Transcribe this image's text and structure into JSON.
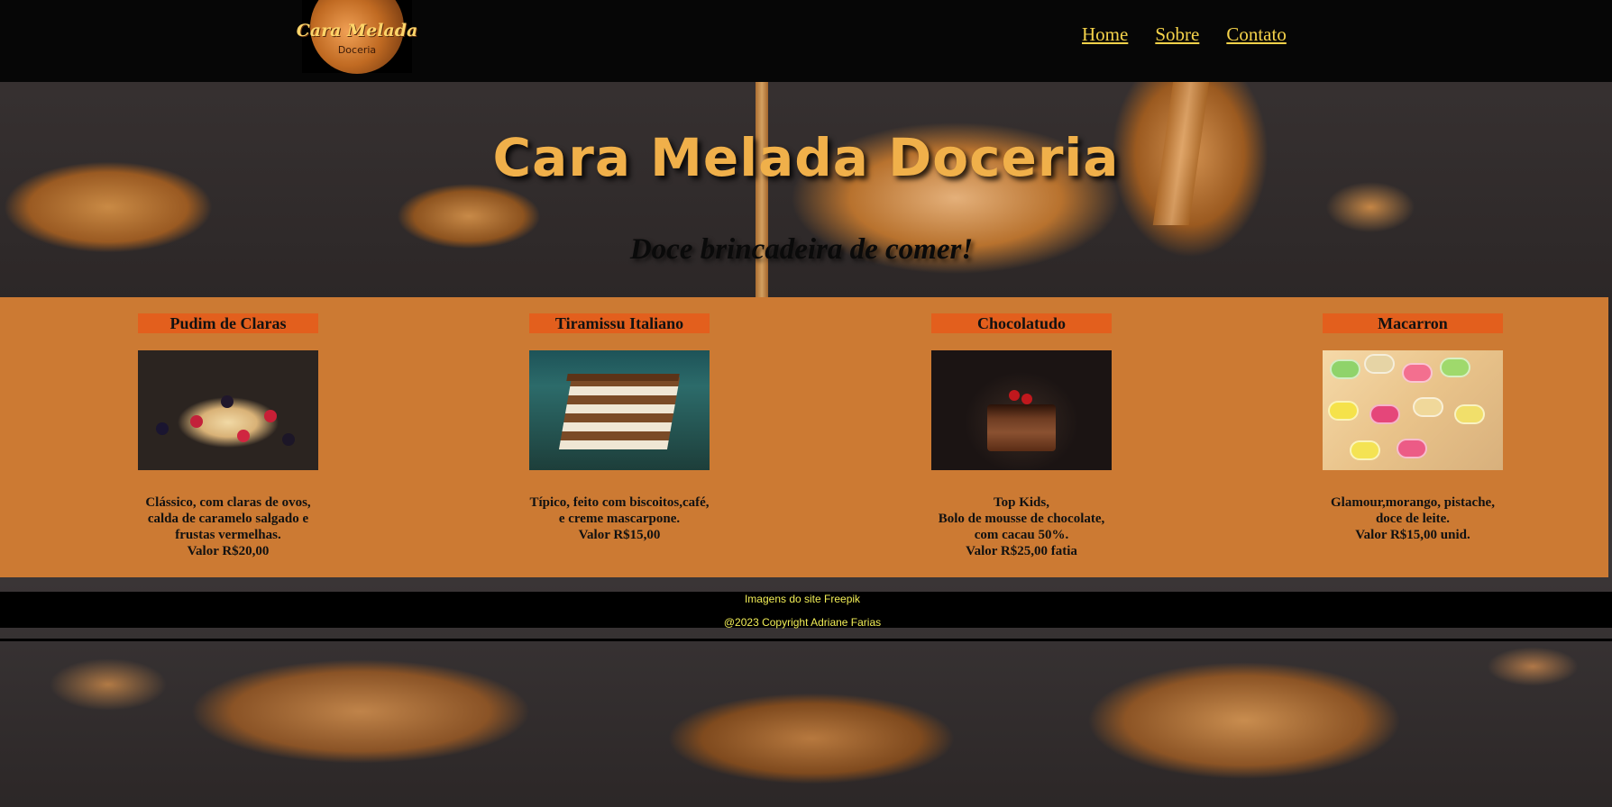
{
  "header": {
    "logo": {
      "script_text": "Cara Melada",
      "sub_text": "Doceria"
    },
    "nav": [
      {
        "label": "Home"
      },
      {
        "label": "Sobre"
      },
      {
        "label": "Contato"
      }
    ]
  },
  "hero": {
    "title": "Cara Melada Doceria",
    "subtitle": "Doce brincadeira de comer!"
  },
  "products": [
    {
      "title": "Pudim de Claras",
      "description": "Clássico, com claras de ovos,\ncalda de caramelo salgado e\nfrustas vermelhas.\nValor R$20,00"
    },
    {
      "title": "Tiramissu Italiano",
      "description": "Típico, feito com biscoitos,café,\ne creme mascarpone.\nValor R$15,00"
    },
    {
      "title": "Chocolatudo",
      "description": "Top Kids,\nBolo de mousse de chocolate,\ncom cacau 50%.\nValor R$25,00 fatia"
    },
    {
      "title": "Macarron",
      "description": "Glamour,morango, pistache,\ndoce de leite.\nValor R$15,00 unid."
    }
  ],
  "footer": {
    "credits": "Imagens do site Freepik",
    "copyright": "@2023 Copyright Adriane Farias"
  },
  "colors": {
    "header_bg": "#060606",
    "nav_link": "#f4d24a",
    "hero_title": "#f0b04a",
    "products_bg": "#cc7a33",
    "card_title_bg": "#e35f1d",
    "footer_text": "#f2ee56"
  }
}
